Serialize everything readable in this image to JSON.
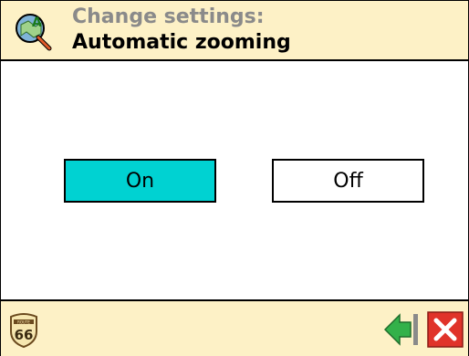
{
  "header": {
    "title_line1": "Change settings:",
    "title_line2": "Automatic zooming",
    "icon": "settings-map-magnifier-icon"
  },
  "options": {
    "on_label": "On",
    "off_label": "Off",
    "selected": "On"
  },
  "footer": {
    "route_badge": {
      "icon": "route-66-icon",
      "top_text": "ROUTE",
      "number": "66"
    },
    "back_icon": "back-arrow-icon",
    "close_icon": "close-icon"
  },
  "colors": {
    "header_bg": "#fdf1c6",
    "selected_bg": "#00d2d2",
    "title_gray": "#8a8a8a",
    "close_red": "#e0332a",
    "back_green": "#33b14a"
  }
}
